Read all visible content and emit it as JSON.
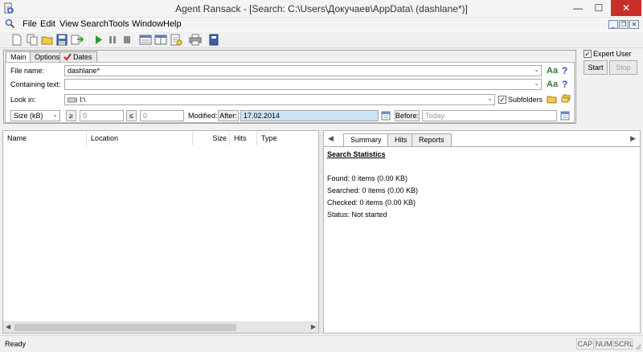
{
  "window": {
    "title": "Agent Ransack - [Search: C:\\Users\\Докучаев\\AppData\\ (dashlane*)]",
    "minimize": "—",
    "maximize": "☐",
    "close": "✕"
  },
  "menu": [
    "File",
    "Edit",
    "View",
    "Search",
    "Tools",
    "Window",
    "Help"
  ],
  "mdi": {
    "minimize": "_",
    "restore": "❐",
    "close": "✕"
  },
  "tabs": [
    "Main",
    "Options",
    "Dates"
  ],
  "form": {
    "file_name_label": "File name:",
    "file_name_value": "dashlane*",
    "containing_text_label": "Containing text:",
    "containing_text_value": "",
    "look_in_label": "Look in:",
    "look_in_value": "I:\\",
    "subfolders_label": "Subfolders",
    "subfolders_checked": true,
    "size_select": "Size (kB)",
    "gte_label": "≥",
    "gte_value": "0",
    "lte_label": "≤",
    "lte_value": "0",
    "modified_label": "Modified:",
    "after_label": "After:",
    "after_value": "17.02.2014",
    "before_label": "Before:",
    "before_placeholder": "Today",
    "aa_label": "Aa",
    "help_label": "?"
  },
  "controls": {
    "expert_user_label": "Expert User",
    "expert_user_checked": true,
    "start_label": "Start",
    "stop_label": "Stop"
  },
  "columns": [
    "Name",
    "Location",
    "Size",
    "Hits",
    "Type"
  ],
  "right_tabs": [
    "Summary",
    "Hits",
    "Reports"
  ],
  "stats": {
    "heading": "Search Statistics",
    "found": "Found: 0 items (0.00 KB)",
    "searched": "Searched: 0 items (0.00 KB)",
    "checked": "Checked: 0 items (0.00 KB)",
    "status": "Status: Not started"
  },
  "statusbar": {
    "text": "Ready",
    "cap": "CAP",
    "num": "NUM",
    "scrl": "SCRL"
  },
  "colors": {
    "after_highlight": "#cce4f7",
    "aa_green": "#2f7d2f",
    "help_blue": "#2a56c6",
    "close_red": "#c7302a"
  }
}
